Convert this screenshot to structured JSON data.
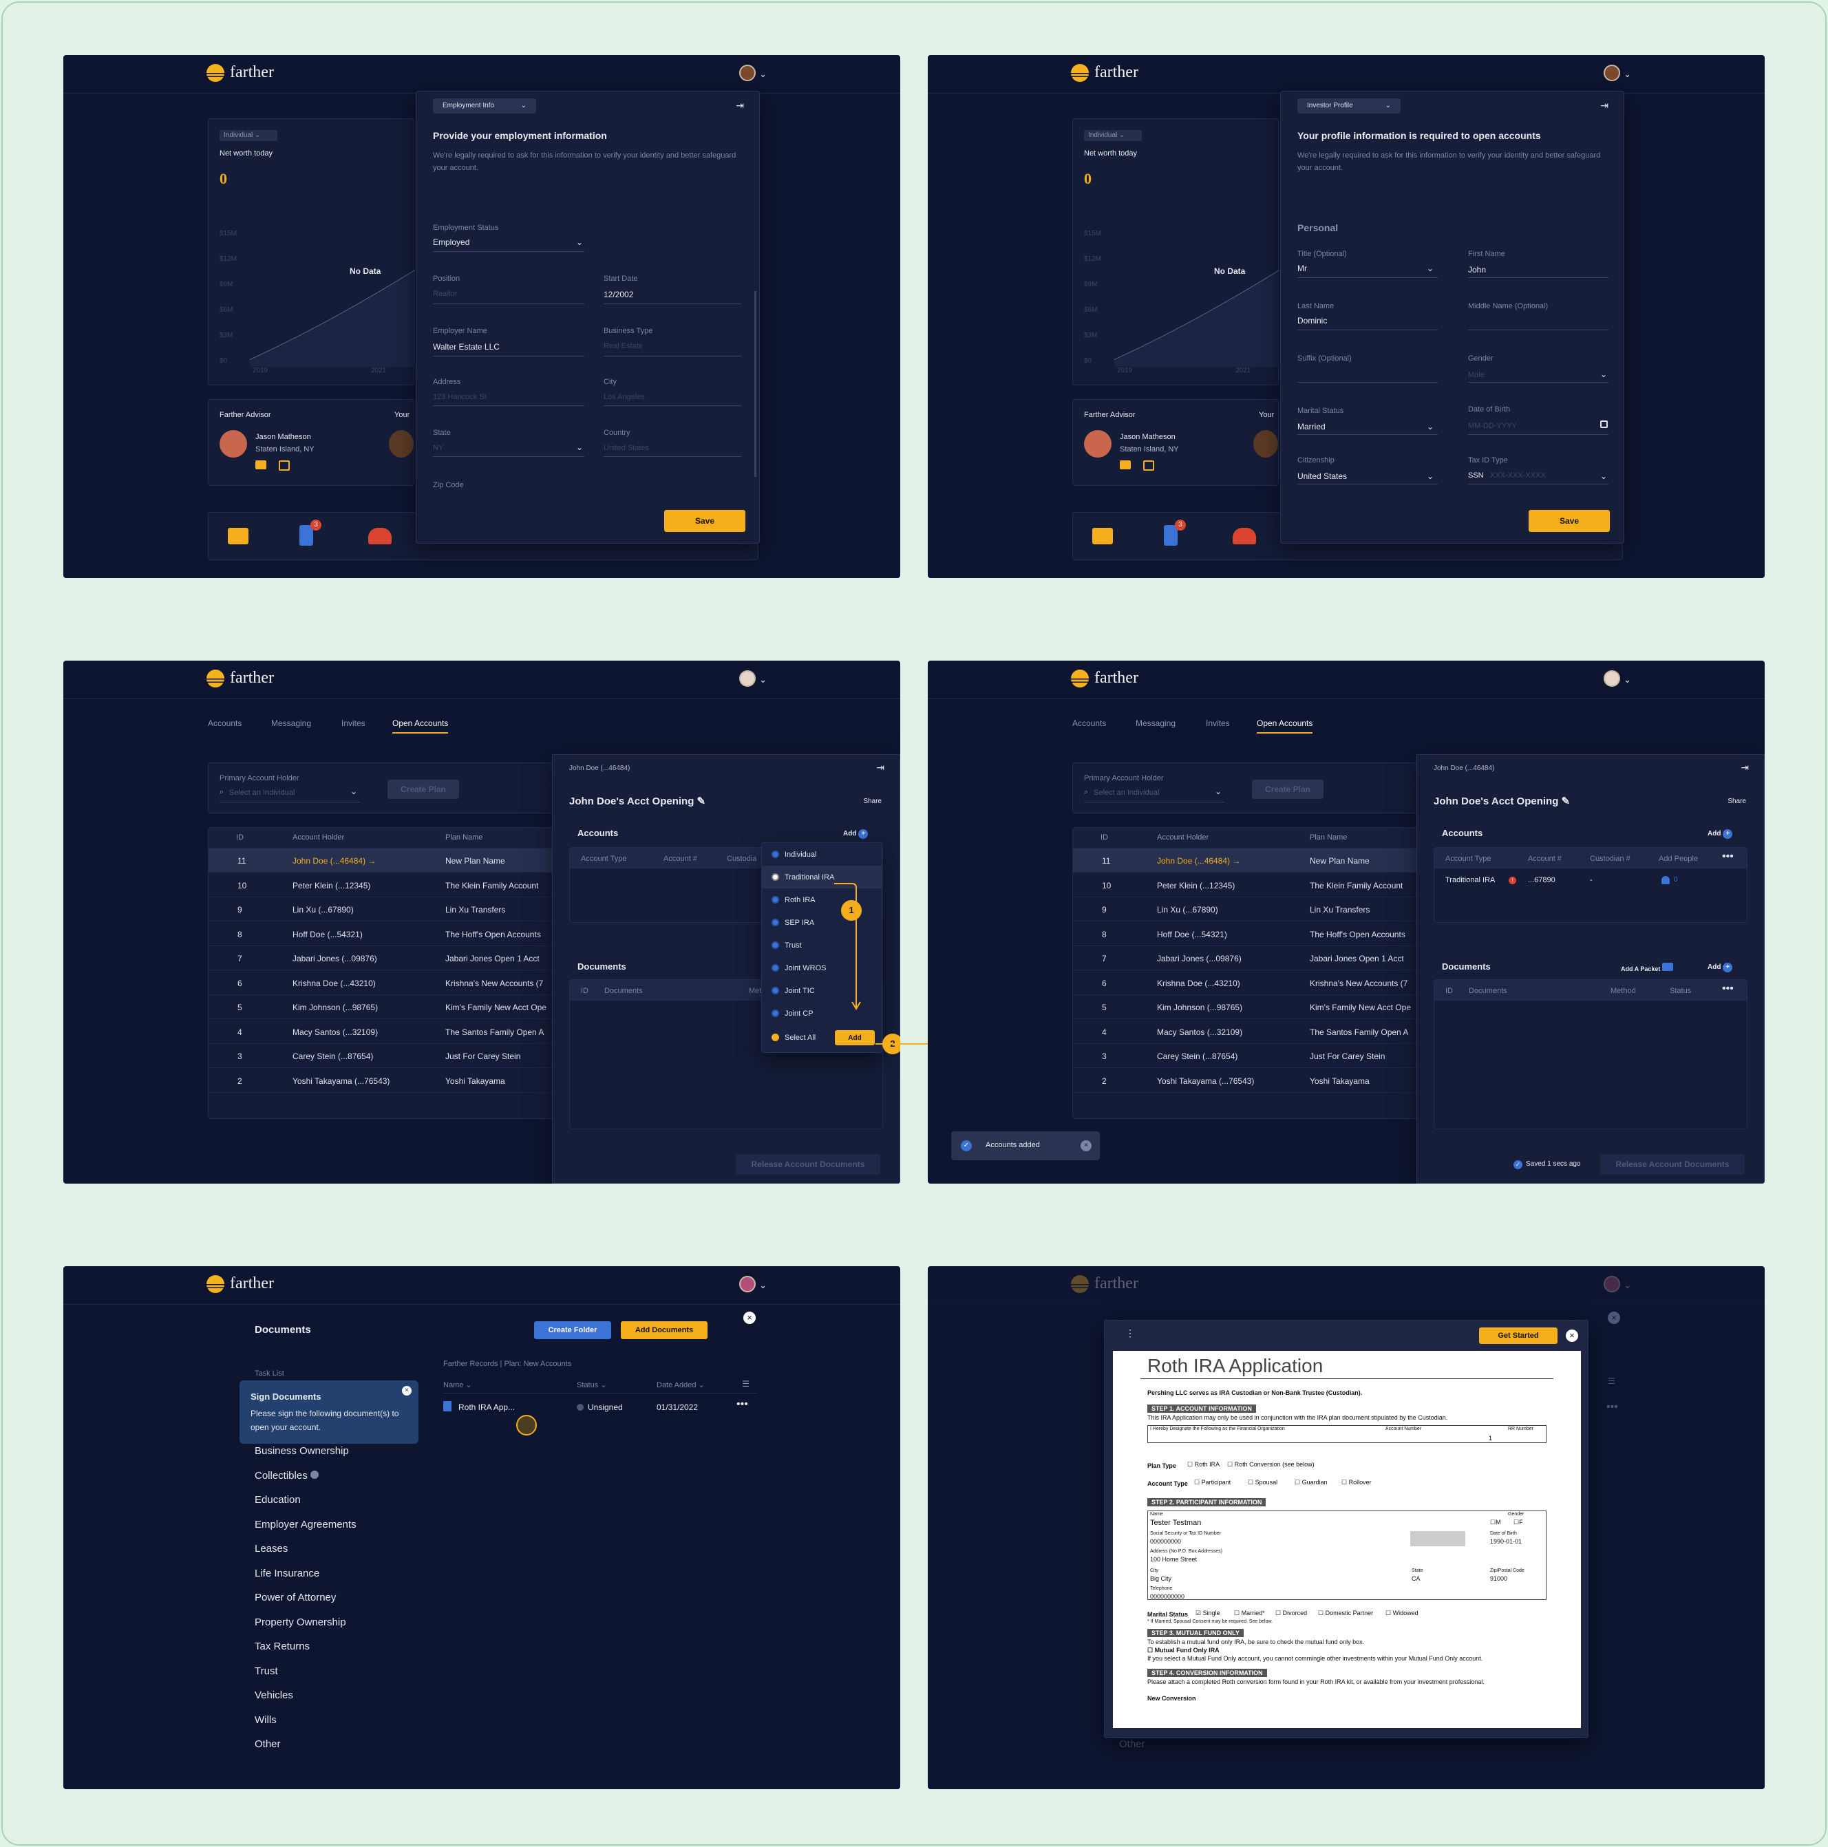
{
  "brand": "farther",
  "common": {
    "net_worth_selector": "Individual",
    "net_worth_label": "Net worth today",
    "net_worth_value": "0",
    "y_ticks": [
      "$15M",
      "$12M",
      "$9M",
      "$6M",
      "$3M",
      "$0"
    ],
    "x_ticks": [
      "2019",
      "2021"
    ],
    "no_data": "No Data",
    "advisor_heading": "Farther Advisor",
    "advisor_name": "Jason Matheson",
    "advisor_location": "Staten Island, NY",
    "your_heading": "Your",
    "badge_count": "3",
    "save": "Save"
  },
  "employment": {
    "dropdown": "Employment Info",
    "title": "Provide your employment information",
    "desc": "We're legally required to ask for this information to verify your identity and better safeguard your account.",
    "status_label": "Employment Status",
    "status_value": "Employed",
    "position_label": "Position",
    "position_ph": "Realtor",
    "start_label": "Start Date",
    "start_value": "12/2002",
    "employer_label": "Employer Name",
    "employer_value": "Walter Estate LLC",
    "btype_label": "Business Type",
    "btype_ph": "Real Estate",
    "address_label": "Address",
    "address_ph": "123 Hancock St",
    "city_label": "City",
    "city_ph": "Los Angeles",
    "state_label": "State",
    "state_ph": "NY",
    "country_label": "Country",
    "country_ph": "United States",
    "zip_label": "Zip Code"
  },
  "profile": {
    "dropdown": "Investor Profile",
    "title": "Your profile information is required to open accounts",
    "desc": "We're legally required to ask for this information to verify your identity and better safeguard your account.",
    "section": "Personal",
    "title_label": "Title (Optional)",
    "title_value": "Mr",
    "first_label": "First Name",
    "first_value": "John",
    "last_label": "Last Name",
    "last_value": "Dominic",
    "middle_label": "Middle Name (Optional)",
    "suffix_label": "Suffix (Optional)",
    "gender_label": "Gender",
    "gender_ph": "Male",
    "marital_label": "Marital Status",
    "marital_value": "Married",
    "dob_label": "Date of Birth",
    "dob_ph": "MM-DD-YYYY",
    "citizen_label": "Citizenship",
    "citizen_value": "United States",
    "taxid_label": "Tax ID Type",
    "taxid_value": "SSN",
    "taxid_ph": "XXX-XXX-XXXX"
  },
  "open_accounts": {
    "tabs": [
      "Accounts",
      "Messaging",
      "Invites",
      "Open Accounts"
    ],
    "holder_label": "Primary Account Holder",
    "holder_ph": "Select an Individual",
    "create_plan": "Create Plan",
    "col_id": "ID",
    "col_holder": "Account Holder",
    "col_plan": "Plan Name",
    "rows": [
      {
        "id": "11",
        "holder": "John Doe (...46484) →",
        "plan": "New Plan Name"
      },
      {
        "id": "10",
        "holder": "Peter Klein (...12345)",
        "plan": "The Klein Family Account"
      },
      {
        "id": "9",
        "holder": "Lin Xu (...67890)",
        "plan": "Lin Xu Transfers"
      },
      {
        "id": "8",
        "holder": "Hoff Doe (...54321)",
        "plan": "The Hoff's Open Accounts"
      },
      {
        "id": "7",
        "holder": "Jabari Jones (...09876)",
        "plan": "Jabari Jones Open 1 Acct"
      },
      {
        "id": "6",
        "holder": "Krishna Doe (...43210)",
        "plan": "Krishna's New Accounts (7"
      },
      {
        "id": "5",
        "holder": "Kim Johnson (...98765)",
        "plan": "Kim's Family New Acct Ope"
      },
      {
        "id": "4",
        "holder": "Macy Santos (...32109)",
        "plan": "The Santos Family Open A"
      },
      {
        "id": "3",
        "holder": "Carey Stein (...87654)",
        "plan": "Just For Carey Stein"
      },
      {
        "id": "2",
        "holder": "Yoshi Takayama (...76543)",
        "plan": "Yoshi Takayama"
      }
    ],
    "drawer_holder": "John Doe (...46484)",
    "drawer_title": "John Doe's Acct Opening",
    "share": "Share",
    "accounts_heading": "Accounts",
    "add": "Add",
    "col_type": "Account Type",
    "col_num": "Account #",
    "col_cust": "Custodian #",
    "col_cust_short": "Custodia",
    "col_people": "Add People",
    "documents_heading": "Documents",
    "col_docs": "Documents",
    "col_method": "Method",
    "col_method_short": "Met",
    "col_status": "Status",
    "add_packet": "Add A Packet",
    "release": "Release Account Documents",
    "dropdown_items": [
      "Individual",
      "Traditional IRA",
      "Roth IRA",
      "SEP IRA",
      "Trust",
      "Joint WROS",
      "Joint TIC",
      "Joint CP"
    ],
    "select_all": "Select All",
    "step1": "1",
    "step2": "2",
    "added_type": "Traditional IRA",
    "added_num": "...67890",
    "added_cust": "-",
    "added_people": "0",
    "toast": "Accounts added",
    "saved": "Saved 1 secs ago"
  },
  "documents": {
    "title": "Documents",
    "create_folder": "Create Folder",
    "add_documents": "Add Documents",
    "task_list": "Task List",
    "tooltip_title": "Sign Documents",
    "tooltip_body": "Please sign the following document(s) to open your account.",
    "breadcrumb": "Farther Records | Plan: New Accounts",
    "col_name": "Name",
    "col_status": "Status",
    "col_date": "Date Added",
    "file_name": "Roth IRA App...",
    "file_status": "Unsigned",
    "file_date": "01/31/2022",
    "categories": [
      "Business Ownership",
      "Collectibles",
      "Education",
      "Employer Agreements",
      "Leases",
      "Life Insurance",
      "Power of Attorney",
      "Property Ownership",
      "Tax Returns",
      "Trust",
      "Vehicles",
      "Wills",
      "Other"
    ]
  },
  "roth": {
    "get_started": "Get Started",
    "title": "Roth IRA Application",
    "subtitle": "Pershing LLC serves as IRA Custodian or Non-Bank Trustee (Custodian).",
    "step1": "STEP 1. ACCOUNT INFORMATION",
    "step1_text": "This IRA Application may only be used in conjunction with the IRA plan document stipulated by the Custodian.",
    "org_label": "I Hereby Designate the Following as the Financial Organization",
    "acct_label": "Account Number",
    "rr_label": "RR Number",
    "acct_digit": "1",
    "plan_type": "Plan Type",
    "roth_ira": "Roth IRA",
    "roth_conv": "Roth Conversion (see below)",
    "acct_type": "Account Type",
    "participant": "Participant",
    "spousal": "Spousal",
    "guardian": "Guardian",
    "rollover": "Rollover",
    "step2": "STEP 2. PARTICIPANT INFORMATION",
    "name_label": "Name",
    "name": "Tester Testman",
    "gender_label": "Gender",
    "m": "M",
    "f": "F",
    "ssn_label": "Social Security or Tax ID Number",
    "ssn": "000000000",
    "dob_label": "Date of Birth",
    "dob": "1990-01-01",
    "addr_label": "Address (No P.O. Box Addresses)",
    "addr": "100 Home Street",
    "city_label": "City",
    "city": "Big City",
    "state_label": "State",
    "state": "CA",
    "zip_label": "Zip/Postal Code",
    "zip": "91000",
    "tel_label": "Telephone",
    "tel": "0000000000",
    "marital": "Marital Status",
    "single": "Single",
    "married": "Married*",
    "divorced": "Divorced",
    "domestic": "Domestic Partner",
    "widowed": "Widowed",
    "married_note": "* If Married, Spousal Consent may be required. See below.",
    "step3": "STEP 3. MUTUAL FUND ONLY",
    "step3_text": "To establish a mutual fund only IRA, be sure to check the mutual fund only box.",
    "mf_only": "Mutual Fund Only IRA",
    "mf_text": "If you select a Mutual Fund Only account, you cannot commingle other investments within your Mutual Fund Only account.",
    "step4": "STEP 4. CONVERSION INFORMATION",
    "step4_text": "Please attach a completed Roth conversion form found in your Roth IRA kit, or available from your investment professional.",
    "new_conv": "New Conversion",
    "other": "Other"
  }
}
